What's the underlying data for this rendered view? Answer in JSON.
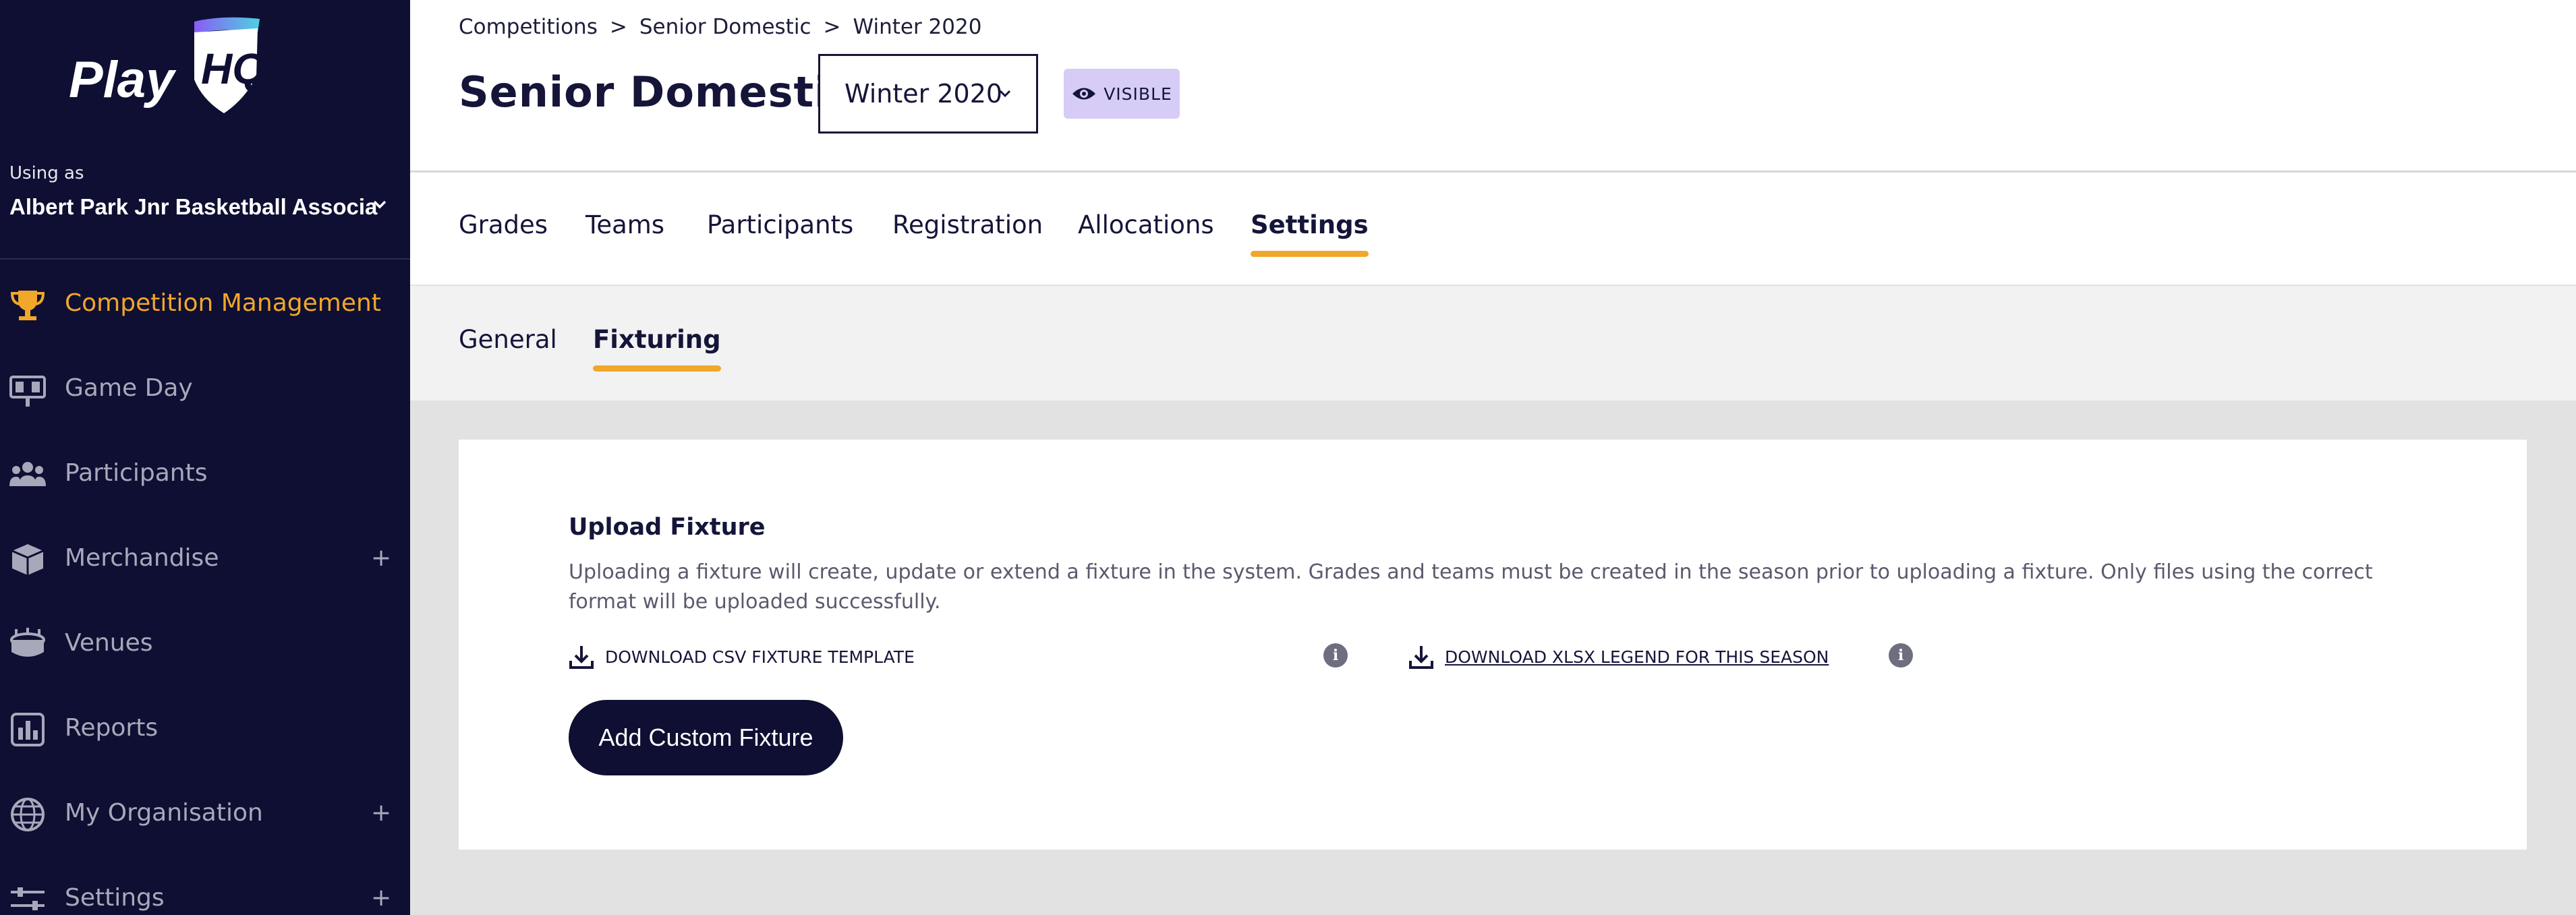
{
  "brand": {
    "logo_text": "PlayHQ",
    "accent": "#f0a72a",
    "navy": "#0f0f33",
    "badge_bg": "#d7ccf5"
  },
  "org": {
    "using_as": "Using as",
    "name": "Albert Park Jnr Basketball Associa"
  },
  "nav": [
    {
      "label": "Competition Management",
      "icon": "trophy-icon",
      "active": true,
      "expandable": false
    },
    {
      "label": "Game Day",
      "icon": "scoreboard-icon",
      "active": false,
      "expandable": false
    },
    {
      "label": "Participants",
      "icon": "people-icon",
      "active": false,
      "expandable": false
    },
    {
      "label": "Merchandise",
      "icon": "box-icon",
      "active": false,
      "expandable": true
    },
    {
      "label": "Venues",
      "icon": "stadium-icon",
      "active": false,
      "expandable": false
    },
    {
      "label": "Reports",
      "icon": "report-chart-icon",
      "active": false,
      "expandable": false
    },
    {
      "label": "My Organisation",
      "icon": "globe-icon",
      "active": false,
      "expandable": true
    },
    {
      "label": "Settings",
      "icon": "sliders-icon",
      "active": false,
      "expandable": true
    }
  ],
  "nav_plus": "+",
  "breadcrumb": [
    "Competitions",
    "Senior Domestic",
    "Winter 2020"
  ],
  "breadcrumb_sep": ">",
  "page_title": "Senior Domestic",
  "season_select": {
    "value": "Winter 2020"
  },
  "visibility_badge": "VISIBLE",
  "tabs": [
    "Grades",
    "Teams",
    "Participants",
    "Registration",
    "Allocations",
    "Settings"
  ],
  "active_tab": "Settings",
  "subtabs": [
    "General",
    "Fixturing"
  ],
  "active_subtab": "Fixturing",
  "upload": {
    "title": "Upload Fixture",
    "description": "Uploading a fixture will create, update or extend a fixture in the system. Grades and teams must be created in the season prior to uploading a fixture. Only files using the correct format will be uploaded successfully.",
    "csv_link": "DOWNLOAD CSV FIXTURE TEMPLATE",
    "xlsx_link": "DOWNLOAD XLSX LEGEND FOR THIS SEASON",
    "info_glyph": "i",
    "add_button": "Add Custom Fixture"
  }
}
